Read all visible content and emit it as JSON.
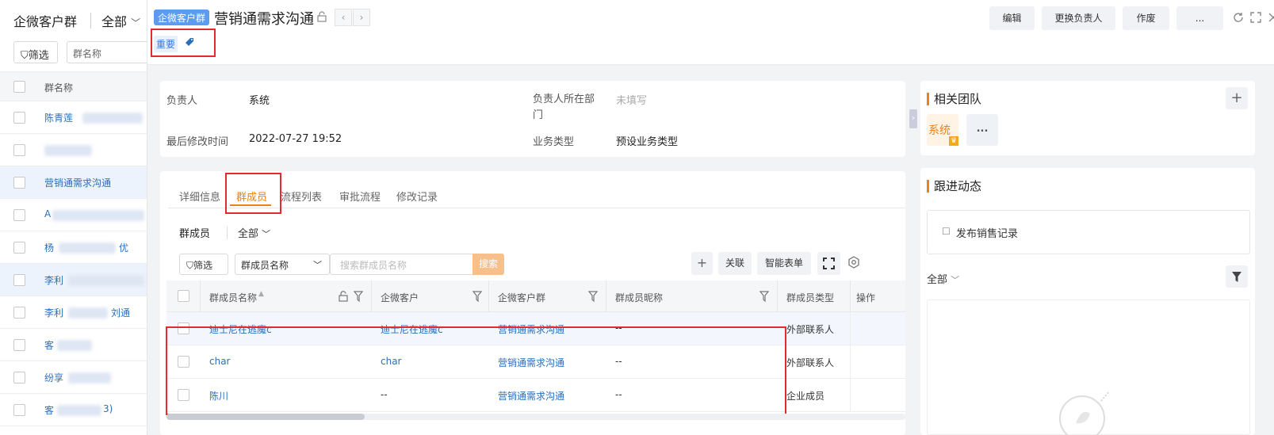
{
  "left_panel": {
    "title": "企微客户群",
    "scope": "全部",
    "filter_label": "筛选",
    "name_placeholder": "群名称",
    "column_header": "群名称",
    "rows": [
      {
        "label": "陈青莲"
      },
      {
        "label": ""
      },
      {
        "label": "营销通需求沟通"
      },
      {
        "label": "A"
      },
      {
        "label": "杨"
      },
      {
        "label": "李利"
      },
      {
        "label": "李利"
      },
      {
        "label": "客"
      },
      {
        "label": "纷享"
      },
      {
        "label": "客"
      }
    ],
    "row_suffixes": {
      "r4": "优",
      "r6": "刘通",
      "r9": "3)"
    }
  },
  "header": {
    "type_badge": "企微客户群",
    "title": "营销通需求沟通",
    "tag": "重要",
    "buttons": {
      "edit": "编辑",
      "change_owner": "更换负责人",
      "void": "作废",
      "more": "..."
    }
  },
  "info": {
    "owner_label": "负责人",
    "owner_value": "系统",
    "dept_label": "负责人所在部门",
    "dept_value": "未填写",
    "modified_label": "最后修改时间",
    "modified_value": "2022-07-27 19:52",
    "biz_type_label": "业务类型",
    "biz_type_value": "预设业务类型"
  },
  "tabs": [
    "详细信息",
    "群成员",
    "流程列表",
    "审批流程",
    "修改记录"
  ],
  "members": {
    "section_label": "群成员",
    "scope": "全部",
    "filter_label": "筛选",
    "field_select": "群成员名称",
    "search_placeholder": "搜索群成员名称",
    "search_button": "搜索",
    "link_button": "关联",
    "smart_form_button": "智能表单",
    "columns": [
      "群成员名称",
      "企微客户",
      "企微客户群",
      "群成员昵称",
      "群成员类型",
      "操作"
    ],
    "rows": [
      {
        "name": "迪士尼在逃魔c",
        "customer": "迪士尼在逃魔c",
        "group": "营销通需求沟通",
        "nickname": "--",
        "type": "外部联系人"
      },
      {
        "name": "char",
        "customer": "char",
        "group": "营销通需求沟通",
        "nickname": "--",
        "type": "外部联系人"
      },
      {
        "name": "陈川",
        "customer": "--",
        "group": "营销通需求沟通",
        "nickname": "--",
        "type": "企业成员"
      }
    ]
  },
  "team": {
    "title": "相关团队",
    "member": "系统",
    "more": "..."
  },
  "follow": {
    "title": "跟进动态",
    "publish": "发布销售记录",
    "scope": "全部"
  },
  "colors": {
    "accent_orange": "#e8831a",
    "link_blue": "#2a6ebb",
    "highlight_red": "#e32b2b",
    "badge_blue": "#5b9bf0"
  }
}
